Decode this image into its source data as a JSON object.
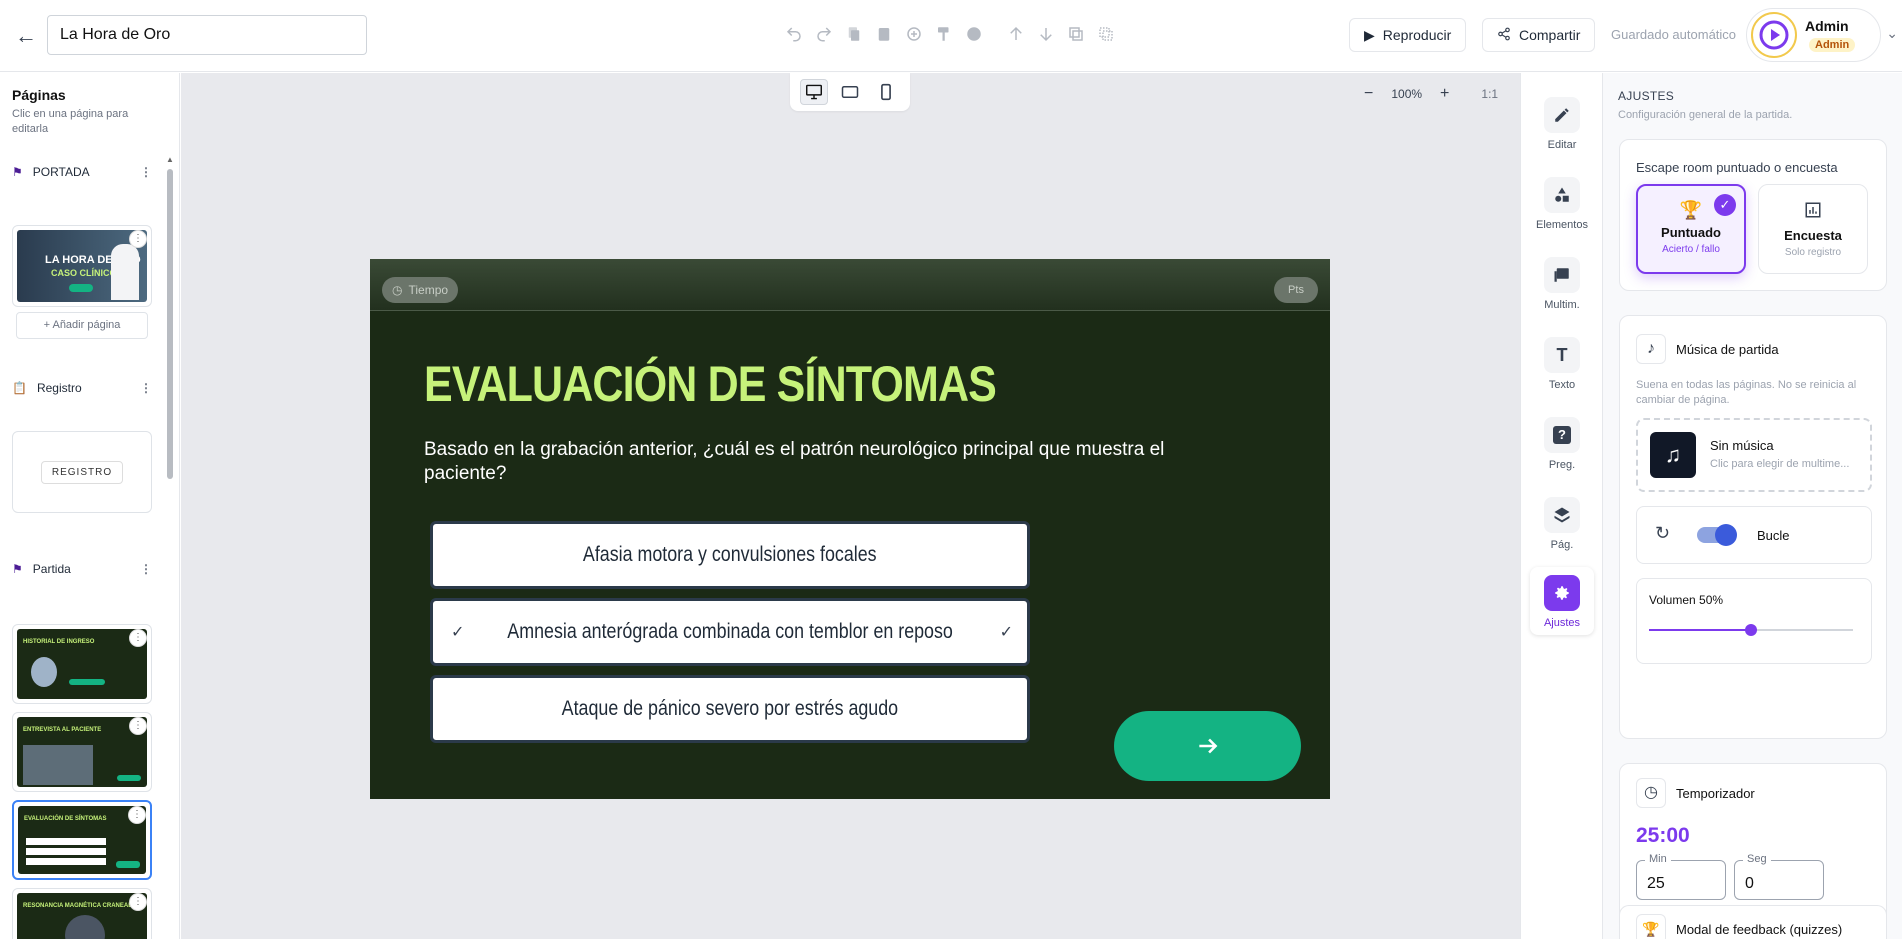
{
  "topbar": {
    "title_value": "La Hora de Oro",
    "play_label": "Reproducir",
    "share_label": "Compartir",
    "autosave": "Guardado automático",
    "user_name": "Admin",
    "user_role": "Admin"
  },
  "pages": {
    "heading": "Páginas",
    "hint": "Clic en una página para editarla",
    "add_page": "+ Añadir página",
    "sections": [
      {
        "label": "PORTADA"
      },
      {
        "label": "Registro"
      },
      {
        "label": "Partida"
      }
    ],
    "cover_title": "LA HORA DE ORO",
    "cover_sub": "CASO CLÍNICO",
    "registro_label": "REGISTRO",
    "thumbs": [
      {
        "title": "HISTORIAL DE INGRESO"
      },
      {
        "title": "ENTREVISTA AL PACIENTE"
      },
      {
        "title": "EVALUACIÓN DE SÍNTOMAS"
      },
      {
        "title": "RESONANCIA MAGNÉTICA CRANEAL"
      }
    ]
  },
  "canvas": {
    "zoom": "100%",
    "ratio": "1:1"
  },
  "slide": {
    "timer_label": "Tiempo",
    "right_pill": "Pts",
    "title": "EVALUACIÓN DE SÍNTOMAS",
    "question": "Basado en la grabación anterior, ¿cuál es el patrón neurológico principal que muestra el paciente?",
    "answers": [
      {
        "text": "Afasia motora y convulsiones focales",
        "selected": false
      },
      {
        "text": "Amnesia anterógrada combinada con temblor en reposo",
        "selected": true
      },
      {
        "text": "Ataque de pánico severo por estrés agudo",
        "selected": false
      }
    ],
    "colors": {
      "bg": "#1b2a15",
      "title": "#c6f27a",
      "next": "#14b383"
    }
  },
  "rail": [
    {
      "label": "Editar",
      "icon": "pencil-icon"
    },
    {
      "label": "Elementos",
      "icon": "shapes-icon"
    },
    {
      "label": "Multim.",
      "icon": "image-icon"
    },
    {
      "label": "Texto",
      "icon": "text-icon"
    },
    {
      "label": "Preg.",
      "icon": "question-icon"
    },
    {
      "label": "Pág.",
      "icon": "layers-icon"
    },
    {
      "label": "Ajustes",
      "icon": "gear-icon",
      "active": true
    }
  ],
  "settings": {
    "heading": "AJUSTES",
    "subheading": "Configuración general de la partida.",
    "mode_label": "Escape room puntuado o encuesta",
    "mode_scored": {
      "title": "Puntuado",
      "sub": "Acierto / fallo"
    },
    "mode_survey": {
      "title": "Encuesta",
      "sub": "Solo registro"
    },
    "music_title": "Música de partida",
    "music_hint": "Suena en todas las páginas. No se reinicia al cambiar de página.",
    "music_none": "Sin música",
    "music_pick": "Clic para elegir de multime...",
    "loop_label": "Bucle",
    "volume_label": "Volumen 50%",
    "volume": 0.5,
    "timer_title": "Temporizador",
    "timer_value": "25:00",
    "min_label": "Min",
    "min_value": "25",
    "sec_label": "Seg",
    "sec_value": "0",
    "feedback_title": "Modal de feedback (quizzes)",
    "accent": "#7c3aed"
  }
}
